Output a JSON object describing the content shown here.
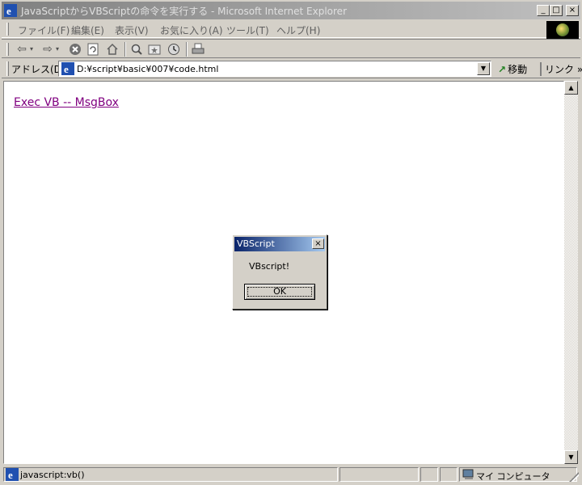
{
  "window": {
    "title": "JavaScriptからVBScriptの命令を実行する - Microsoft Internet Explorer",
    "min_glyph": "_",
    "max_glyph": "□",
    "close_glyph": "×"
  },
  "menu": {
    "items": [
      {
        "label": "ファイル(F)"
      },
      {
        "label": "編集(E)"
      },
      {
        "label": "表示(V)"
      },
      {
        "label": "お気に入り(A)"
      },
      {
        "label": "ツール(T)"
      },
      {
        "label": "ヘルプ(H)"
      }
    ]
  },
  "toolbar": {
    "back_icon": "back-arrow-icon",
    "forward_icon": "forward-arrow-icon",
    "stop_icon": "stop-icon",
    "refresh_icon": "refresh-icon",
    "home_icon": "home-icon",
    "search_icon": "search-icon",
    "favorites_icon": "favorites-icon",
    "history_icon": "history-icon",
    "print_icon": "print-icon"
  },
  "address": {
    "label": "アドレス(D)",
    "value": "D:¥script¥basic¥007¥code.html",
    "go_label": "移動",
    "links_label": "リンク »"
  },
  "content": {
    "link_text": "Exec VB -- MsgBox"
  },
  "dialog": {
    "title": "VBScript",
    "message": "VBscript!",
    "ok_label": "OK",
    "close_glyph": "×"
  },
  "status": {
    "text": "javascript:vb()",
    "zone": "マイ コンピュータ"
  },
  "colors": {
    "chrome": "#d4d0c8",
    "dialog_title_start": "#0a246a",
    "dialog_title_end": "#a6caf0",
    "visited_link": "#800080"
  }
}
